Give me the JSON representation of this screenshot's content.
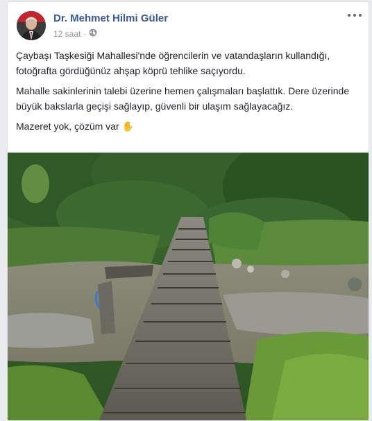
{
  "post": {
    "author": "Dr. Mehmet Hilmi Güler",
    "time": "12 saat",
    "paragraphs": [
      "Çaybaşı Taşkesiği Mahallesi'nde öğrencilerin ve vatandaşların kullandığı, fotoğrafta gördüğünüz ahşap köprü tehlike saçıyordu.",
      "Mahalle sakinlerinin talebi üzerine hemen çalışmaları başlattık. Dere üzerinde büyük bakslarla geçişi sağlayıp, güvenli bir ulaşım sağlayacağız.",
      "Mazeret yok, çözüm var"
    ],
    "emoji": "✋",
    "privacy_icon": "globe-icon",
    "more_icon": "more-options-icon"
  },
  "colors": {
    "author_link": "#365899",
    "meta_text": "#90949c",
    "body_text": "#1d2129",
    "background": "#e9ebee"
  }
}
